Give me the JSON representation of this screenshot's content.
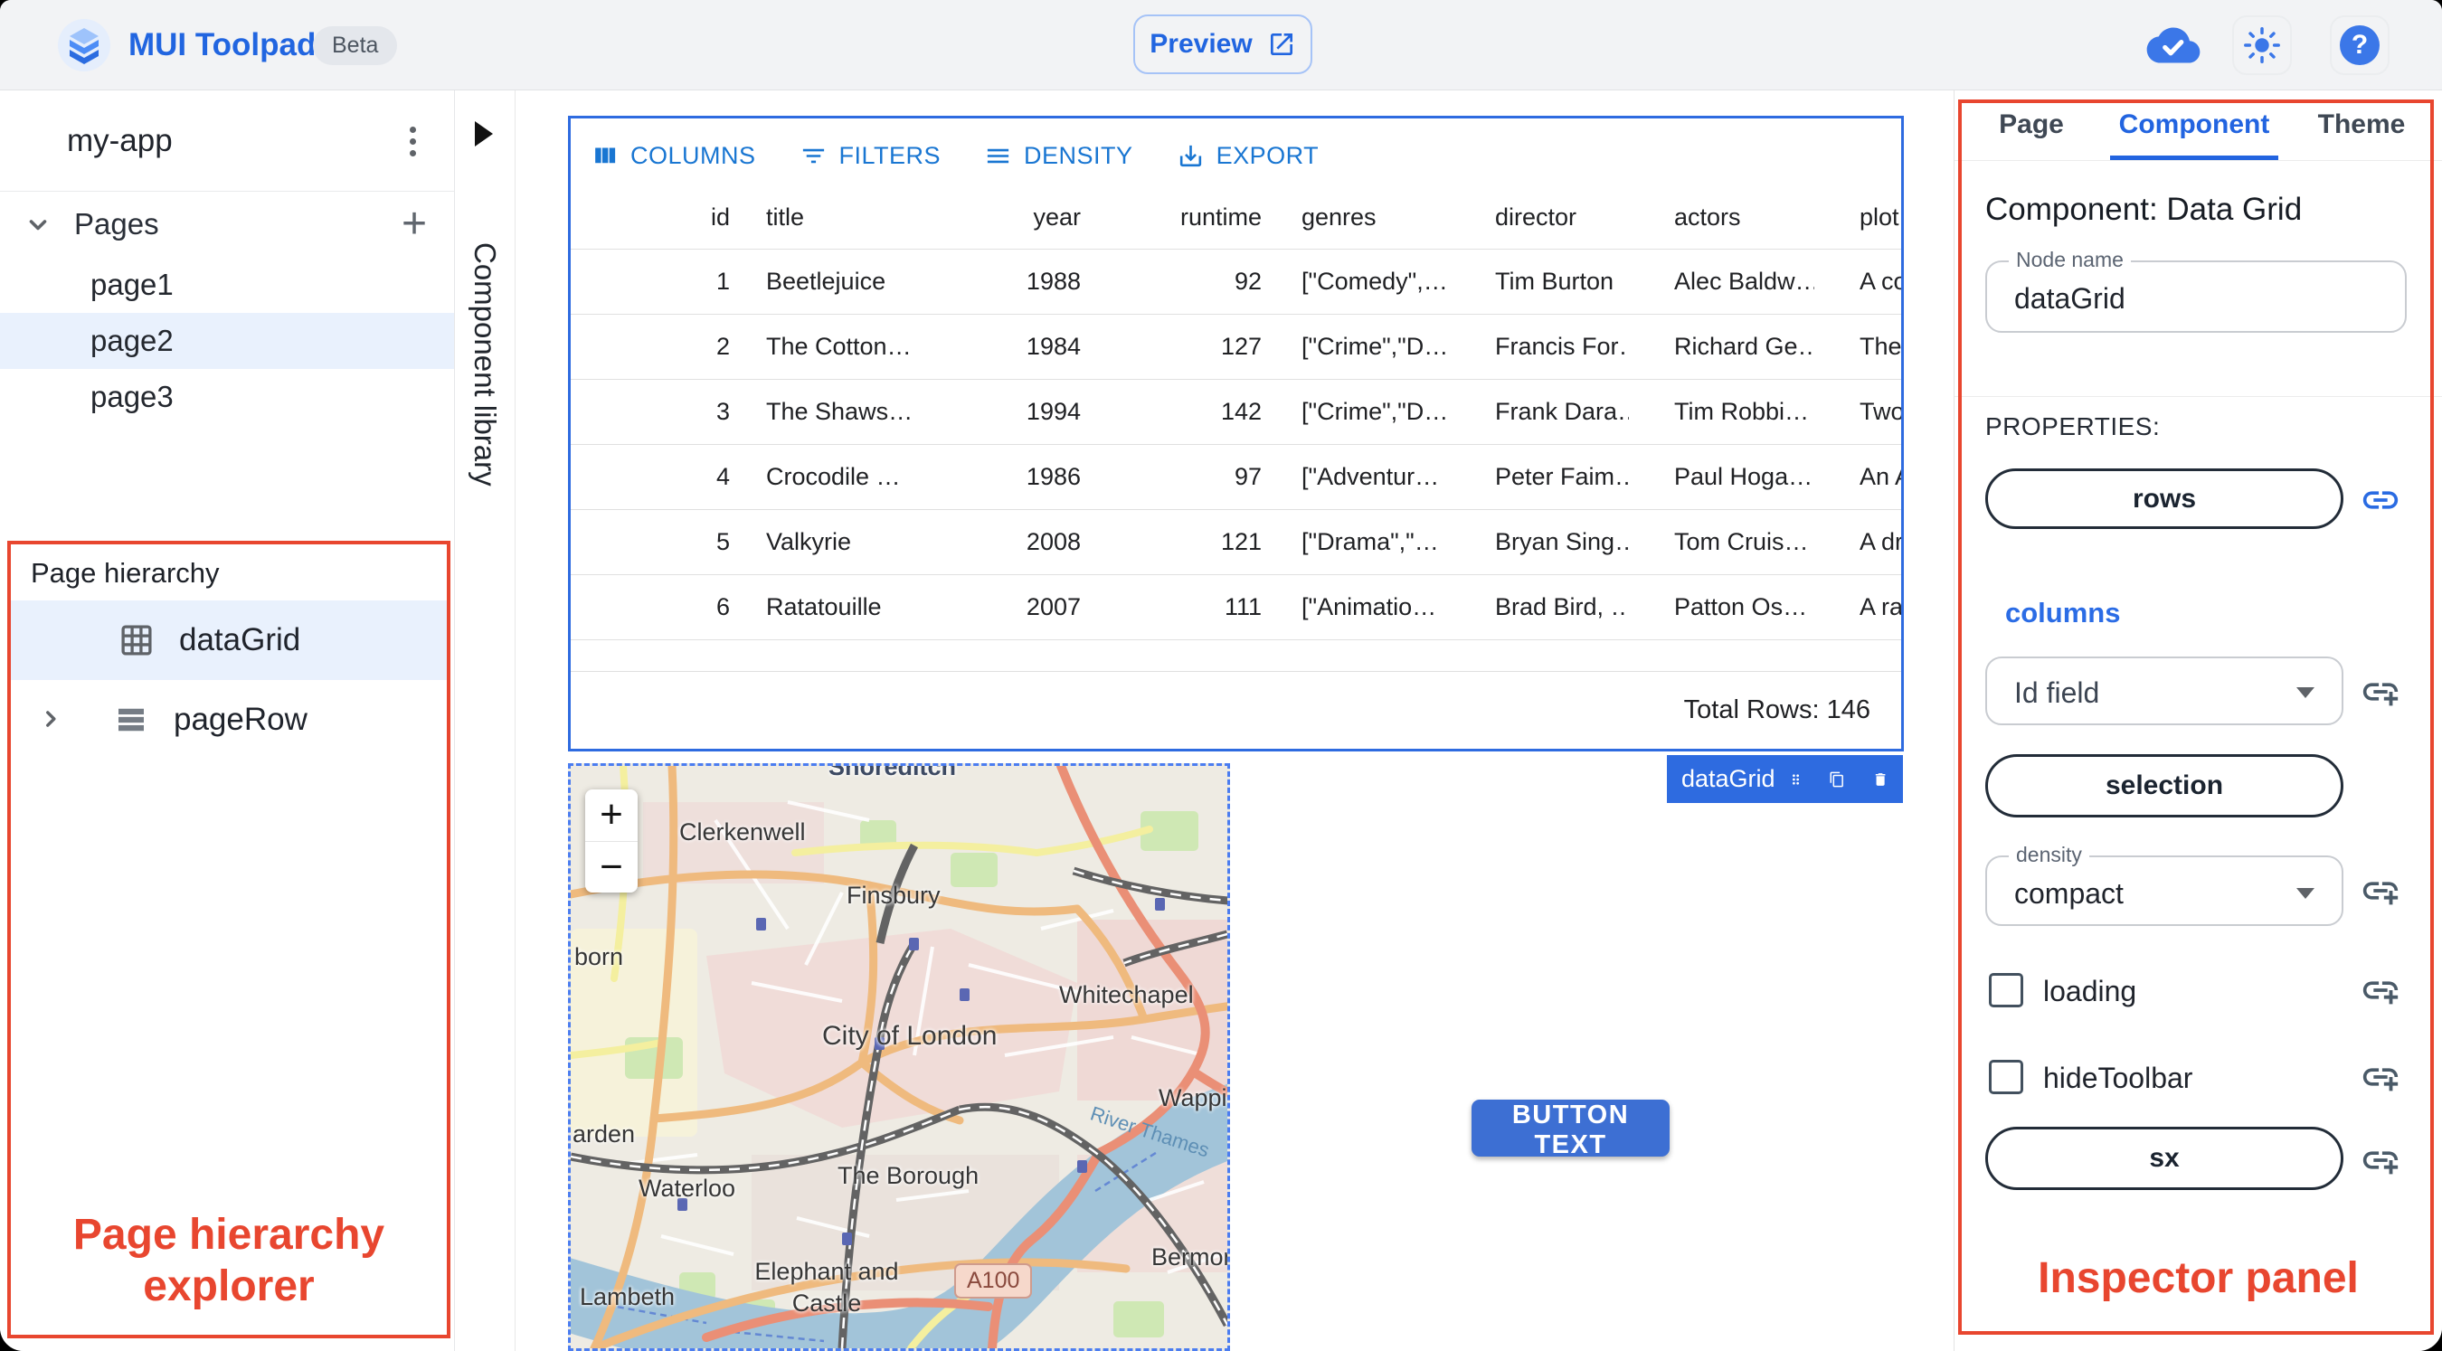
{
  "topbar": {
    "app_name": "MUI Toolpad",
    "beta_badge": "Beta",
    "preview_button": "Preview",
    "help_icon_glyph": "?"
  },
  "sidebar": {
    "app_name": "my-app",
    "pages_section": "Pages",
    "pages": [
      "page1",
      "page2",
      "page3"
    ],
    "selected_page": "page2",
    "add_icon_glyph": "+"
  },
  "component_library": {
    "label": "Component library"
  },
  "page_hierarchy": {
    "title": "Page hierarchy",
    "items": [
      {
        "label": "dataGrid"
      },
      {
        "label": "pageRow"
      }
    ],
    "selected_item": "dataGrid",
    "annotation": "Page hierarchy explorer"
  },
  "data_grid": {
    "toolbar": {
      "columns": "COLUMNS",
      "filters": "FILTERS",
      "density": "DENSITY",
      "export": "EXPORT"
    },
    "columns": [
      "id",
      "title",
      "year",
      "runtime",
      "genres",
      "director",
      "actors",
      "plot"
    ],
    "rows": [
      [
        "1",
        "Beetlejuice",
        "1988",
        "92",
        "[\"Comedy\",…",
        "Tim Burton",
        "Alec Baldw…",
        "A co…"
      ],
      [
        "2",
        "The Cotton…",
        "1984",
        "127",
        "[\"Crime\",\"D…",
        "Francis For…",
        "Richard Ge…",
        "The…"
      ],
      [
        "3",
        "The Shaws…",
        "1994",
        "142",
        "[\"Crime\",\"D…",
        "Frank Dara…",
        "Tim Robbi…",
        "Two…"
      ],
      [
        "4",
        "Crocodile …",
        "1986",
        "97",
        "[\"Adventur…",
        "Peter Faim…",
        "Paul Hoga…",
        "An A…"
      ],
      [
        "5",
        "Valkyrie",
        "2008",
        "121",
        "[\"Drama\",\"…",
        "Bryan Sing…",
        "Tom Cruis…",
        "A dr…"
      ],
      [
        "6",
        "Ratatouille",
        "2007",
        "111",
        "[\"Animatio…",
        "Brad Bird, …",
        "Patton Os…",
        "A ra…"
      ]
    ],
    "footer": "Total Rows: 146",
    "selection_chip": "dataGrid"
  },
  "map": {
    "zoom_in": "+",
    "zoom_out": "−",
    "labels": {
      "shoreditch": "Shoreditch",
      "clerkenwell": "Clerkenwell",
      "finsbury": "Finsbury",
      "holborn": "born",
      "whitechapel": "Whitechapel",
      "city_of_london": "City of London",
      "garden": "arden",
      "waterloo": "Waterloo",
      "the_borough": "The Borough",
      "wapping": "Wapping",
      "river_thames": "River Thames",
      "lambeth": "Lambeth",
      "elephant_castle": "Elephant and Castle",
      "bermondsey": "Bermondse",
      "a100": "A100"
    }
  },
  "button": {
    "label": "BUTTON TEXT"
  },
  "inspector": {
    "tabs": [
      "Page",
      "Component",
      "Theme"
    ],
    "active_tab": "Component",
    "heading": "Component: Data Grid",
    "node_name": {
      "label": "Node name",
      "value": "dataGrid"
    },
    "properties_heading": "PROPERTIES:",
    "rows_prop": "rows",
    "columns_prop": "columns",
    "id_field": {
      "value": "Id field"
    },
    "selection_prop": "selection",
    "density": {
      "label": "density",
      "value": "compact"
    },
    "loading_prop": "loading",
    "hide_toolbar_prop": "hideToolbar",
    "sx_prop": "sx",
    "annotation": "Inspector panel"
  },
  "colors": {
    "primary": "#2e6be0",
    "annotation_red": "#e8462f",
    "toolbar_blue": "#1976d2"
  }
}
